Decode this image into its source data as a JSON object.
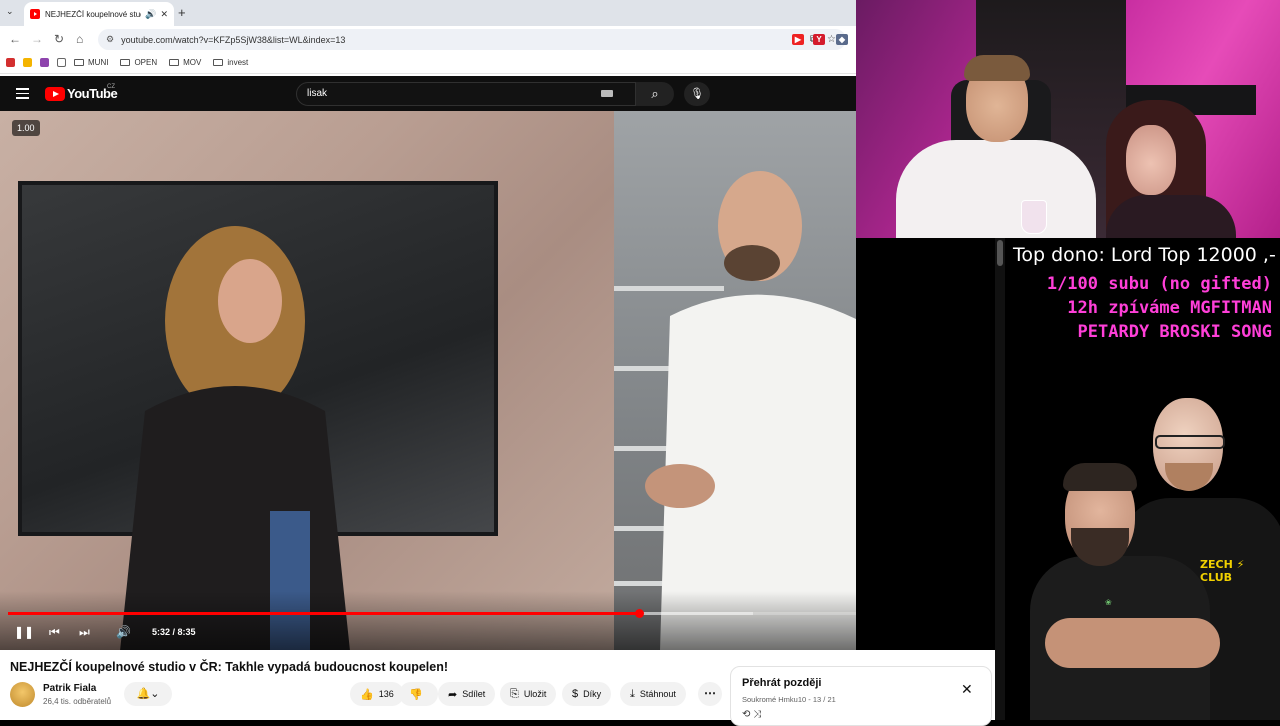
{
  "browser": {
    "tab_title": "NEJHEZČÍ koupelnové studi",
    "url": "youtube.com/watch?v=KFZp5SjW38&list=WL&index=13",
    "bookmarks": [
      "MUNI",
      "OPEN",
      "MOV",
      "invest"
    ]
  },
  "youtube": {
    "logo_text": "YouTube",
    "logo_country": "CZ",
    "search_value": "lisak"
  },
  "player": {
    "speed_badge": "1.00",
    "time_display": "5:32 / 8:35",
    "progress_fraction": 0.644,
    "buffered_fraction": 0.76
  },
  "video": {
    "title": "NEJHEZČÍ koupelnové studio v ČR: Takhle vypadá budoucnost koupelen!",
    "channel_name": "Patrik Fiala",
    "subscribers": "26,4 tis. odběratelů",
    "like_count": "136",
    "share_label": "Sdílet",
    "save_label": "Uložit",
    "thanks_label": "Díky",
    "download_label": "Stáhnout"
  },
  "playlist": {
    "title": "Přehrát později",
    "subtitle": "Soukromé  Hmku10 - 13 / 21"
  },
  "overlay": {
    "top_dono": "Top dono: Lord Top 12000 ,-",
    "goal_line1": "1/100 subu (no gifted)",
    "goal_line2": "12h zpíváme MGFITMAN",
    "goal_line3": "PETARDY BROSKI SONG"
  },
  "colors": {
    "youtube_red": "#ff0000",
    "overlay_pink": "#ff3fd8",
    "yt_dark": "#0f0f0f"
  }
}
